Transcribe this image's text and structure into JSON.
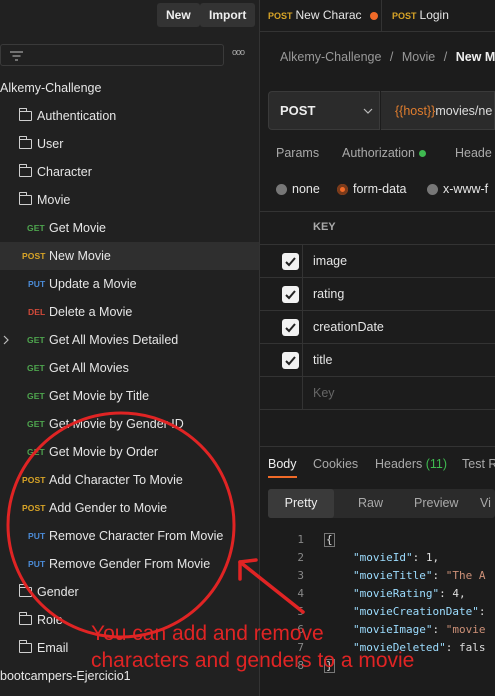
{
  "sidebar": {
    "new_label": "New",
    "import_label": "Import",
    "more_label": "ooo",
    "collection_name": "Alkemy-Challenge",
    "folders_top": [
      "Authentication",
      "User",
      "Character",
      "Movie"
    ],
    "movie_requests": [
      {
        "method": "GET",
        "label": "Get Movie"
      },
      {
        "method": "POST",
        "label": "New Movie"
      },
      {
        "method": "PUT",
        "label": "Update a Movie"
      },
      {
        "method": "DEL",
        "label": "Delete a Movie"
      },
      {
        "method": "GET",
        "label": "Get All Movies Detailed"
      },
      {
        "method": "GET",
        "label": "Get All Movies"
      },
      {
        "method": "GET",
        "label": "Get Movie by Title"
      },
      {
        "method": "GET",
        "label": "Get Movie by Gender ID"
      },
      {
        "method": "GET",
        "label": "Get Movie by Order"
      },
      {
        "method": "POST",
        "label": "Add Character To Movie"
      },
      {
        "method": "POST",
        "label": "Add Gender to Movie"
      },
      {
        "method": "PUT",
        "label": "Remove Character From Movie"
      },
      {
        "method": "PUT",
        "label": "Remove Gender From Movie"
      }
    ],
    "folders_bottom": [
      "Gender",
      "Role",
      "Email"
    ],
    "next_collection": "bootcampers-Ejercicio1"
  },
  "tabs": [
    {
      "method": "POST",
      "label": "New Charac"
    },
    {
      "method": "POST",
      "label": "Login"
    }
  ],
  "breadcrumb": {
    "collection": "Alkemy-Challenge",
    "sep": "/",
    "folder": "Movie",
    "request": "New M"
  },
  "request": {
    "method": "POST",
    "url_var": "{{host}}",
    "url_path": "movies/ne"
  },
  "request_tabs": [
    "Params",
    "Authorization",
    "Heade"
  ],
  "body_types": [
    "none",
    "form-data",
    "x-www-f"
  ],
  "form": {
    "key_header": "KEY",
    "rows": [
      "image",
      "rating",
      "creationDate",
      "title"
    ],
    "placeholder": "Key"
  },
  "response": {
    "tabs": [
      "Body",
      "Cookies",
      "Headers",
      "(11)",
      "Test R"
    ],
    "view_modes": [
      "Pretty",
      "Raw",
      "Preview",
      "Vi"
    ],
    "code": [
      {
        "n": "1",
        "text": "{"
      },
      {
        "n": "2",
        "key": "\"movieId\"",
        "rest": ": 1,"
      },
      {
        "n": "3",
        "key": "\"movieTitle\"",
        "rest": ": ",
        "str": "\"The A"
      },
      {
        "n": "4",
        "key": "\"movieRating\"",
        "rest": ": 4,"
      },
      {
        "n": "5",
        "key": "\"movieCreationDate\"",
        "rest": ":"
      },
      {
        "n": "6",
        "key": "\"movieImage\"",
        "rest": ": ",
        "str": "\"movie"
      },
      {
        "n": "7",
        "key": "\"movieDeleted\"",
        "rest": ": fals"
      },
      {
        "n": "8",
        "text": "}"
      }
    ]
  },
  "annotation": {
    "line1": "You can add and remove",
    "line2": "characters and genders to a movie",
    "color": "#e02424"
  }
}
